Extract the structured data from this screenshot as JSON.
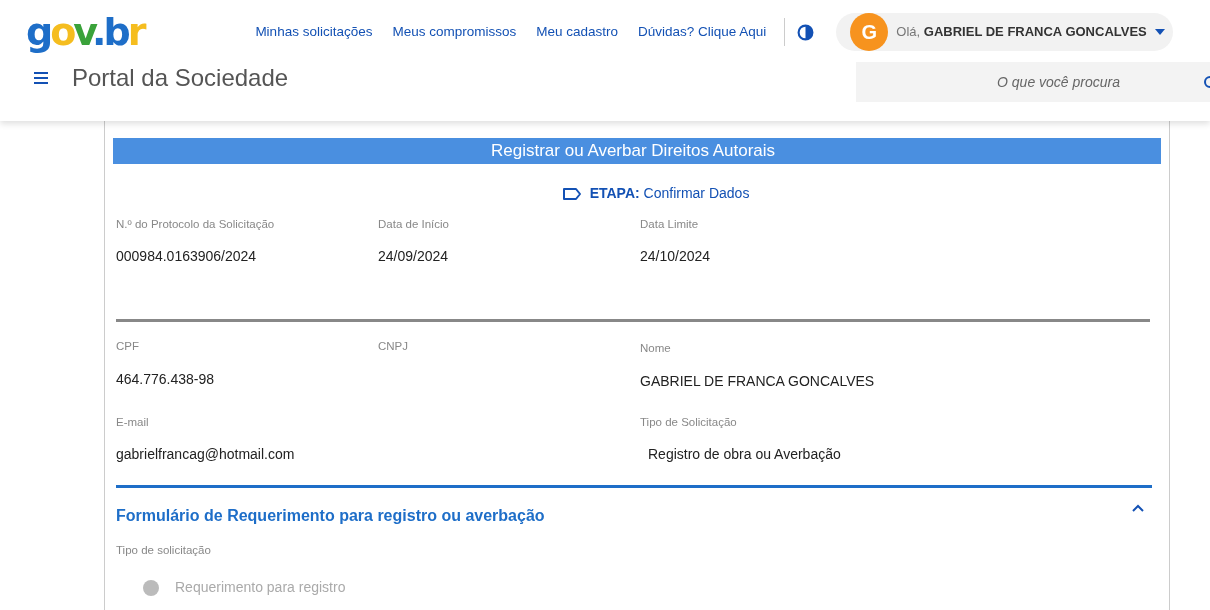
{
  "header": {
    "logo": [
      {
        "text": "g",
        "color": "#1e6ec8"
      },
      {
        "text": "o",
        "color": "#f5bd1f"
      },
      {
        "text": "v",
        "color": "#3aa23a"
      },
      {
        "text": ".b",
        "color": "#1e6ec8"
      },
      {
        "text": "r",
        "color": "#f5bd1f"
      }
    ],
    "links": [
      "Minhas solicitações",
      "Meus compromissos",
      "Meu cadastro",
      "Dúvidas? Clique Aqui"
    ],
    "user": {
      "initial": "G",
      "greeting": "Olá,",
      "name": "GABRIEL DE FRANCA GONCALVES"
    },
    "title": "Portal da Sociedade",
    "search": {
      "placeholder": "O que você procura"
    }
  },
  "banner": "Registrar ou Averbar Direitos Autorais",
  "step": {
    "label": "ETAPA:",
    "value": "Confirmar Dados"
  },
  "protocol_fields": [
    {
      "label": "N.º do Protocolo da Solicitação",
      "value": "000984.0163906/2024"
    },
    {
      "label": "Data de Início",
      "value": "24/09/2024"
    },
    {
      "label": "Data Limite",
      "value": "24/10/2024"
    }
  ],
  "person_fields": [
    {
      "label": "CPF",
      "value": "464.776.438-98"
    },
    {
      "label": "CNPJ"
    },
    {
      "label": "Nome",
      "value": "GABRIEL DE FRANCA GONCALVES"
    },
    {
      "label": "E-mail",
      "value": "gabrielfrancag@hotmail.com"
    },
    {
      "label": "Tipo de Solicitação",
      "value": "Registro de obra ou Averbação"
    }
  ],
  "form_section": {
    "title": "Formulário de Requerimento para registro ou averbação",
    "expanded": true,
    "field_label": "Tipo de solicitação",
    "options": [
      {
        "label": "Requerimento para registro",
        "disabled": true,
        "selected": false
      }
    ]
  }
}
